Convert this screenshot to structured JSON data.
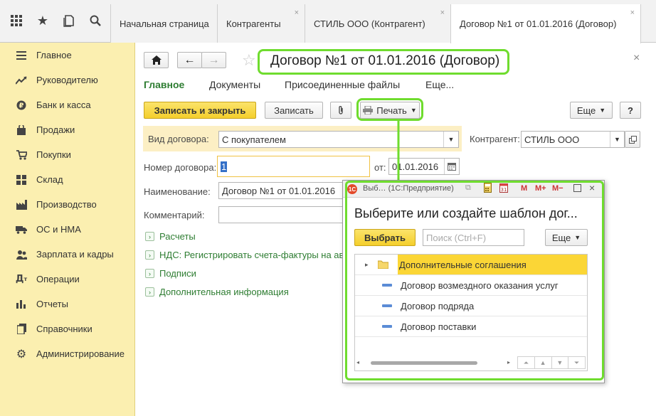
{
  "topbar": {
    "tabs": [
      {
        "label": "Начальная страница"
      },
      {
        "label": "Контрагенты",
        "close": "×"
      },
      {
        "label": "СТИЛЬ ООО (Контрагент)",
        "close": "×"
      },
      {
        "label": "Договор №1 от 01.01.2016 (Договор)",
        "close": "×"
      }
    ]
  },
  "sidebar": {
    "items": [
      {
        "label": "Главное",
        "icon": "menu-icon"
      },
      {
        "label": "Руководителю",
        "icon": "trend-icon"
      },
      {
        "label": "Банк и касса",
        "icon": "coin-icon"
      },
      {
        "label": "Продажи",
        "icon": "bag-icon"
      },
      {
        "label": "Покупки",
        "icon": "cart-icon"
      },
      {
        "label": "Склад",
        "icon": "warehouse-icon"
      },
      {
        "label": "Производство",
        "icon": "factory-icon"
      },
      {
        "label": "ОС и НМА",
        "icon": "truck-icon"
      },
      {
        "label": "Зарплата и кадры",
        "icon": "people-icon"
      },
      {
        "label": "Операции",
        "icon": "operations-icon"
      },
      {
        "label": "Отчеты",
        "icon": "chart-icon"
      },
      {
        "label": "Справочники",
        "icon": "book-icon"
      },
      {
        "label": "Администрирование",
        "icon": "gear-icon"
      }
    ]
  },
  "form": {
    "title": "Договор №1 от 01.01.2016 (Договор)",
    "close": "×",
    "nav_tabs": [
      "Главное",
      "Документы",
      "Присоединенные файлы",
      "Еще..."
    ],
    "toolbar": {
      "save_close": "Записать и закрыть",
      "save": "Записать",
      "print": "Печать",
      "more": "Еще",
      "help": "?"
    },
    "contract_type_label": "Вид договора:",
    "contract_type_value": "С покупателем",
    "counterparty_label": "Контрагент:",
    "counterparty_value": "СТИЛЬ ООО",
    "number_label": "Номер договора:",
    "number_value": "1",
    "date_label": "от:",
    "date_value": "01.01.2016",
    "name_label": "Наименование:",
    "name_value": "Договор №1 от 01.01.2016",
    "comment_label": "Комментарий:",
    "comment_value": "",
    "groups": [
      "Расчеты",
      "НДС: Регистрировать счета-фактуры на ав",
      "Подписи",
      "Дополнительная информация"
    ]
  },
  "modal": {
    "window_title": "Выб… (1С:Предприятие)",
    "title_buttons": [
      "M",
      "M+",
      "M−"
    ],
    "heading": "Выберите или создайте шаблон дог...",
    "select_button": "Выбрать",
    "search_placeholder": "Поиск (Ctrl+F)",
    "more": "Еще",
    "rows": [
      {
        "label": "Дополнительные соглашения",
        "kind": "folder",
        "selected": true
      },
      {
        "label": "Договор возмездного оказания услуг",
        "kind": "item"
      },
      {
        "label": "Договор подряда",
        "kind": "item"
      },
      {
        "label": "Договор поставки",
        "kind": "item"
      }
    ]
  },
  "colors": {
    "sidebar_bg": "#fbefb0",
    "accent_yellow": "#f4cf2c",
    "highlight_green": "#6fdc2e",
    "link_green": "#2e7d32",
    "selected_row": "#fbd636"
  }
}
